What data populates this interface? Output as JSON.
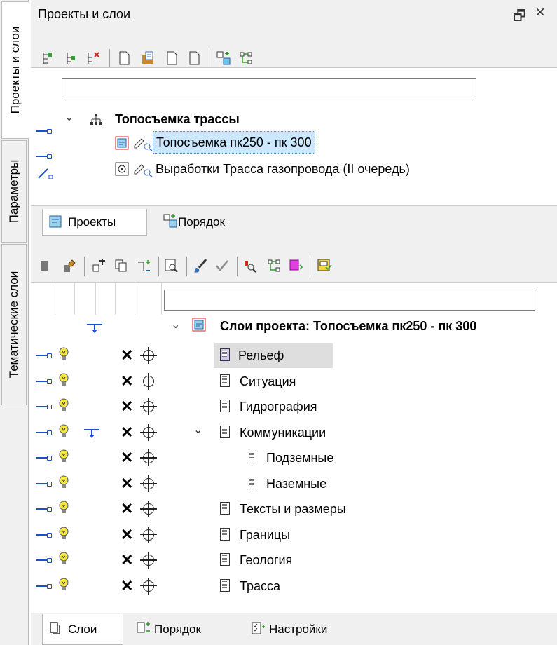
{
  "sidebar": {
    "tabs": [
      {
        "label": "Проекты и слои"
      },
      {
        "label": "Параметры"
      },
      {
        "label": "Тематические слои"
      }
    ]
  },
  "panel": {
    "title": "Проекты и слои",
    "float_glyph": "🗗",
    "close_glyph": "×"
  },
  "projects": {
    "search_value": "",
    "tree": [
      {
        "label": "Топосъемка трассы"
      },
      {
        "label": "Топосъемка пк250 - пк 300"
      },
      {
        "label": "Выработки Трасса газопровода (II очередь)"
      }
    ],
    "tabs": [
      {
        "label": "Проекты"
      },
      {
        "label": "Порядок"
      }
    ]
  },
  "layers": {
    "search_value": "",
    "root_label": "Слои проекта: Топосъемка пк250 - пк 300",
    "items": [
      {
        "label": "Рельеф"
      },
      {
        "label": "Ситуация"
      },
      {
        "label": "Гидрография"
      },
      {
        "label": "Коммуникации"
      },
      {
        "label": "Подземные"
      },
      {
        "label": "Наземные"
      },
      {
        "label": "Тексты и размеры"
      },
      {
        "label": "Границы"
      },
      {
        "label": "Геология"
      },
      {
        "label": "Трасса"
      }
    ],
    "tabs": [
      {
        "label": "Слои"
      },
      {
        "label": "Порядок"
      },
      {
        "label": "Настройки"
      }
    ]
  },
  "colors": {
    "link_blue": "#1a4fcf",
    "bulb_yellow": "#f5e642",
    "selection_bg": "#cce8ff"
  }
}
